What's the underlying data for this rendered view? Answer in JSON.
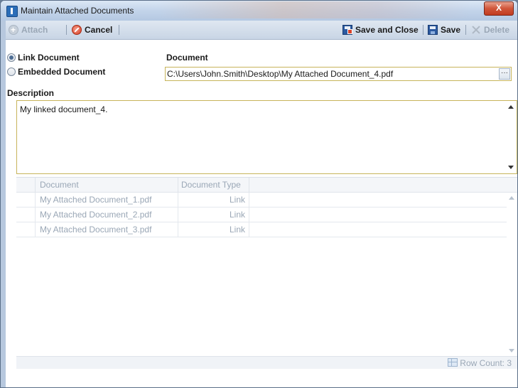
{
  "window": {
    "title": "Maintain Attached Documents",
    "close_label": "X"
  },
  "toolbar": {
    "attach_label": "Attach",
    "cancel_label": "Cancel",
    "save_close_label": "Save and Close",
    "save_label": "Save",
    "delete_label": "Delete"
  },
  "form": {
    "link_option": "Link Document",
    "embedded_option": "Embedded Document",
    "selected_option": "Link Document",
    "document_label": "Document",
    "document_value": "C:\\Users\\John.Smith\\Desktop\\My Attached Document_4.pdf",
    "browse_label": "···",
    "description_label": "Description",
    "description_value": "My linked document_4."
  },
  "grid": {
    "columns": [
      "Document",
      "Document Type"
    ],
    "rows": [
      {
        "document": "My Attached Document_1.pdf",
        "type": "Link"
      },
      {
        "document": "My Attached Document_2.pdf",
        "type": "Link"
      },
      {
        "document": "My Attached Document_3.pdf",
        "type": "Link"
      }
    ],
    "row_count_text": "Row Count: 3"
  },
  "colors": {
    "accent_border": "#c7b45a",
    "disabled_text": "#9aa7b6",
    "close_red": "#c23b1f"
  },
  "icons": [
    "app-icon",
    "attach-icon",
    "cancel-icon",
    "save-close-icon",
    "save-icon",
    "delete-icon",
    "grid-icon"
  ]
}
